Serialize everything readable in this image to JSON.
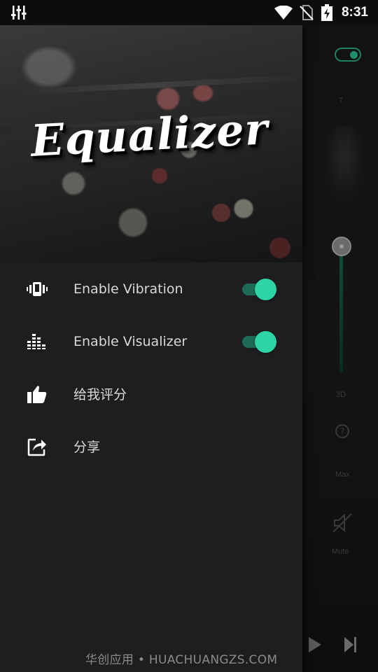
{
  "status_bar": {
    "time": "8:31",
    "icons": [
      "equalizer-notification-icon",
      "wifi-icon",
      "no-sim-icon",
      "battery-charging-icon"
    ]
  },
  "background": {
    "labels": {
      "seven": "7",
      "three_d": "3D",
      "max": "Max",
      "mute": "Mute"
    }
  },
  "drawer": {
    "header_title": "Equalizer",
    "items": [
      {
        "label": "Enable Vibration",
        "icon": "vibration-icon",
        "toggle": true
      },
      {
        "label": "Enable Visualizer",
        "icon": "visualizer-icon",
        "toggle": true
      },
      {
        "label": "给我评分",
        "icon": "thumbs-up-icon"
      },
      {
        "label": "分享",
        "icon": "share-icon"
      }
    ],
    "accent_color": "#2dd4a6"
  },
  "watermark": "华创应用 • HUACHUANGZS.COM"
}
